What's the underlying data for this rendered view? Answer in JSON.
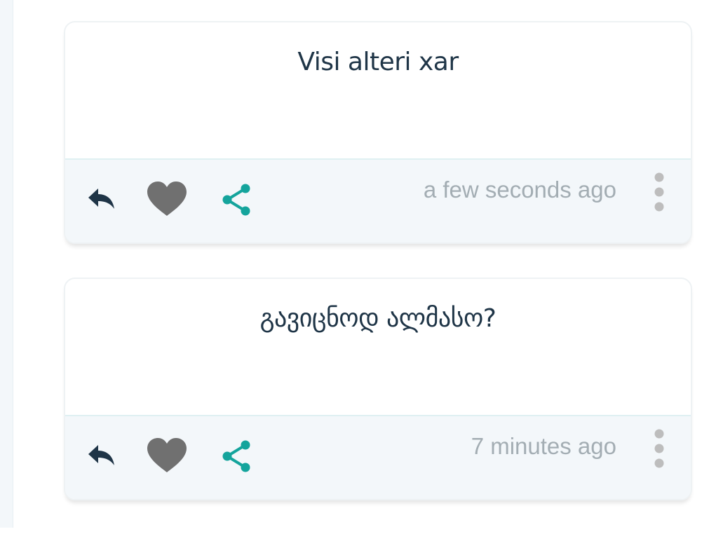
{
  "posts": [
    {
      "text": "Visi alteri xar",
      "time": "a few seconds ago"
    },
    {
      "text": "გავიცნოდ ალმასო?",
      "time": "7 minutes ago"
    }
  ],
  "colors": {
    "reply": "#1f3547",
    "like": "#707070",
    "share": "#14a49c",
    "timestamp": "#a3adb3",
    "more": "#bdbdbd",
    "footer_bg": "#f3f7fa"
  },
  "icons": {
    "reply": "reply-icon",
    "like": "heart-icon",
    "share": "share-icon",
    "more": "more-vertical-icon"
  }
}
